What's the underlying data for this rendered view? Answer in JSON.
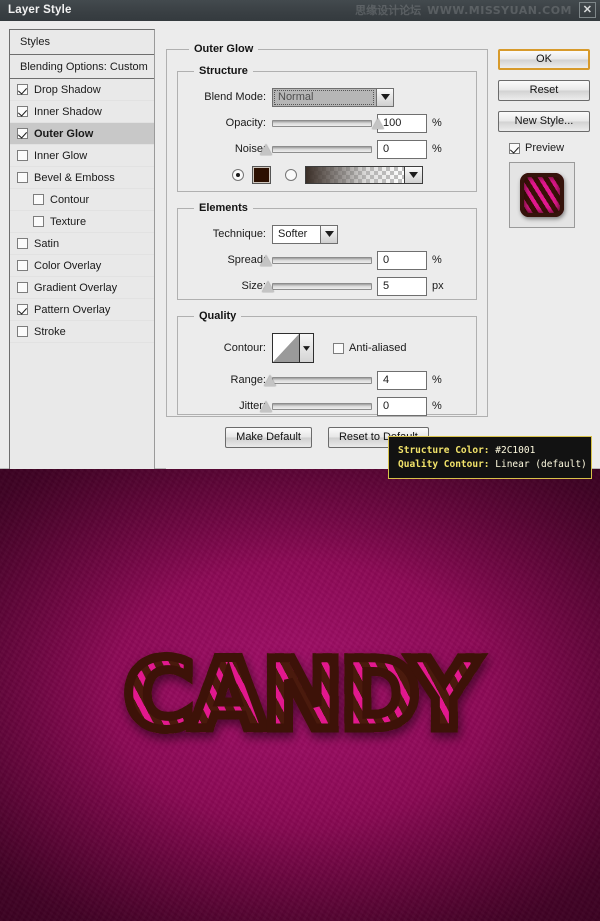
{
  "window": {
    "title": "Layer Style",
    "close_label": "✕",
    "watermark_cjk": "思缘设计论坛",
    "watermark_url": "WWW.MISSYUAN.COM"
  },
  "styles_panel": {
    "header": "Styles",
    "blending_options": "Blending Options: Custom",
    "items": [
      {
        "label": "Drop Shadow",
        "checked": true,
        "sub": false,
        "active": false
      },
      {
        "label": "Inner Shadow",
        "checked": true,
        "sub": false,
        "active": false
      },
      {
        "label": "Outer Glow",
        "checked": true,
        "sub": false,
        "active": true
      },
      {
        "label": "Inner Glow",
        "checked": false,
        "sub": false,
        "active": false
      },
      {
        "label": "Bevel & Emboss",
        "checked": false,
        "sub": false,
        "active": false
      },
      {
        "label": "Contour",
        "checked": false,
        "sub": true,
        "active": false
      },
      {
        "label": "Texture",
        "checked": false,
        "sub": true,
        "active": false
      },
      {
        "label": "Satin",
        "checked": false,
        "sub": false,
        "active": false
      },
      {
        "label": "Color Overlay",
        "checked": false,
        "sub": false,
        "active": false
      },
      {
        "label": "Gradient Overlay",
        "checked": false,
        "sub": false,
        "active": false
      },
      {
        "label": "Pattern Overlay",
        "checked": true,
        "sub": false,
        "active": false
      },
      {
        "label": "Stroke",
        "checked": false,
        "sub": false,
        "active": false
      }
    ]
  },
  "settings": {
    "group_title": "Outer Glow",
    "structure": {
      "title": "Structure",
      "blend_mode_label": "Blend Mode:",
      "blend_mode_value": "Normal",
      "opacity_label": "Opacity:",
      "opacity_value": "100",
      "opacity_unit": "%",
      "opacity_pct": 100,
      "noise_label": "Noise:",
      "noise_value": "0",
      "noise_unit": "%",
      "noise_pct": 0,
      "fill_mode": "color",
      "color_value": "#2C1001",
      "gradient_label": "gradient-preview"
    },
    "elements": {
      "title": "Elements",
      "technique_label": "Technique:",
      "technique_value": "Softer",
      "spread_label": "Spread:",
      "spread_value": "0",
      "spread_unit": "%",
      "spread_pct": 0,
      "size_label": "Size:",
      "size_value": "5",
      "size_unit": "px",
      "size_pct": 2
    },
    "quality": {
      "title": "Quality",
      "contour_label": "Contour:",
      "contour_value": "Linear (default)",
      "anti_aliased_label": "Anti-aliased",
      "anti_aliased_checked": false,
      "range_label": "Range:",
      "range_value": "4",
      "range_unit": "%",
      "range_pct": 4,
      "jitter_label": "Jitter:",
      "jitter_value": "0",
      "jitter_unit": "%",
      "jitter_pct": 0
    },
    "make_default_label": "Make Default",
    "reset_to_default_label": "Reset to Default"
  },
  "right_column": {
    "ok_label": "OK",
    "reset_label": "Reset",
    "new_style_label": "New Style...",
    "preview_label": "Preview",
    "preview_checked": true,
    "thumbnail_name": "layer-style-preview-thumbnail"
  },
  "tooltip": {
    "line1_label": "Structure Color:",
    "line1_value": "#2C1001",
    "line2_label": "Quality Contour:",
    "line2_value": "Linear (default)",
    "accent_color": "#D8C24A",
    "text_color": "#F2E36A"
  },
  "artwork": {
    "text": "CANDY",
    "background_color": "#8D0A56",
    "stripe_color": "#E2188E",
    "outline_color": "#3D1208"
  }
}
